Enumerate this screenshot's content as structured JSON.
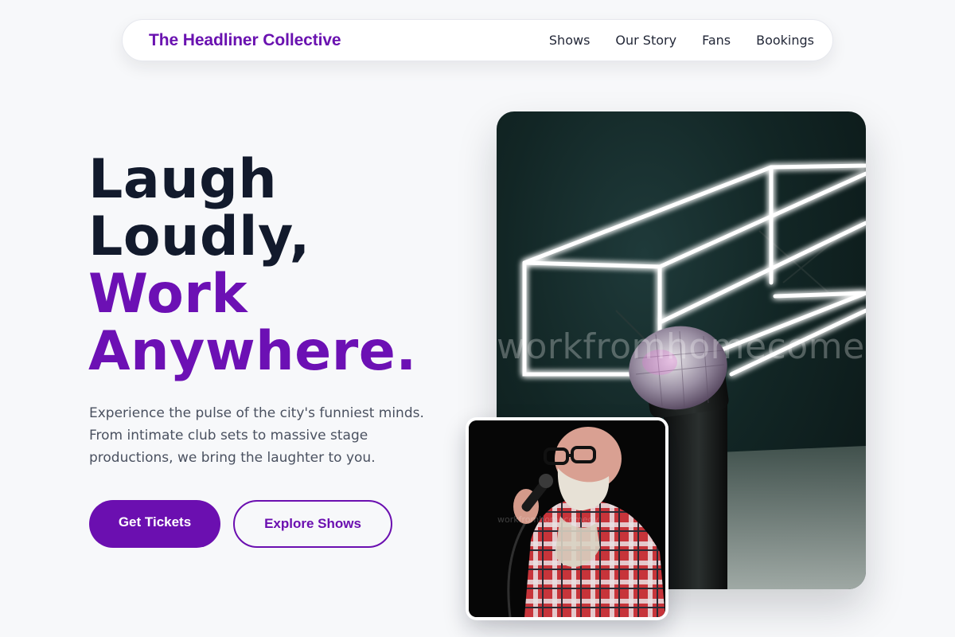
{
  "nav": {
    "brand": "The Headliner Collective",
    "links": [
      "Shows",
      "Our Story",
      "Fans",
      "Bookings"
    ]
  },
  "hero": {
    "headline_dark": [
      "Laugh",
      "Loudly,"
    ],
    "headline_accent": [
      "Work",
      "Anywhere."
    ],
    "subtitle": "Experience the pulse of the city's funniest minds. From intimate club sets to massive stage productions, we bring the laughter to you.",
    "primary_cta": "Get Tickets",
    "secondary_cta": "Explore Shows"
  },
  "images": {
    "main_watermark": "workfromhomecomedy.c",
    "small_watermark": "workfromhomecomedy"
  },
  "colors": {
    "accent": "#6b0fb0",
    "dark_text": "#121a2c",
    "background": "#f7f8fa"
  }
}
